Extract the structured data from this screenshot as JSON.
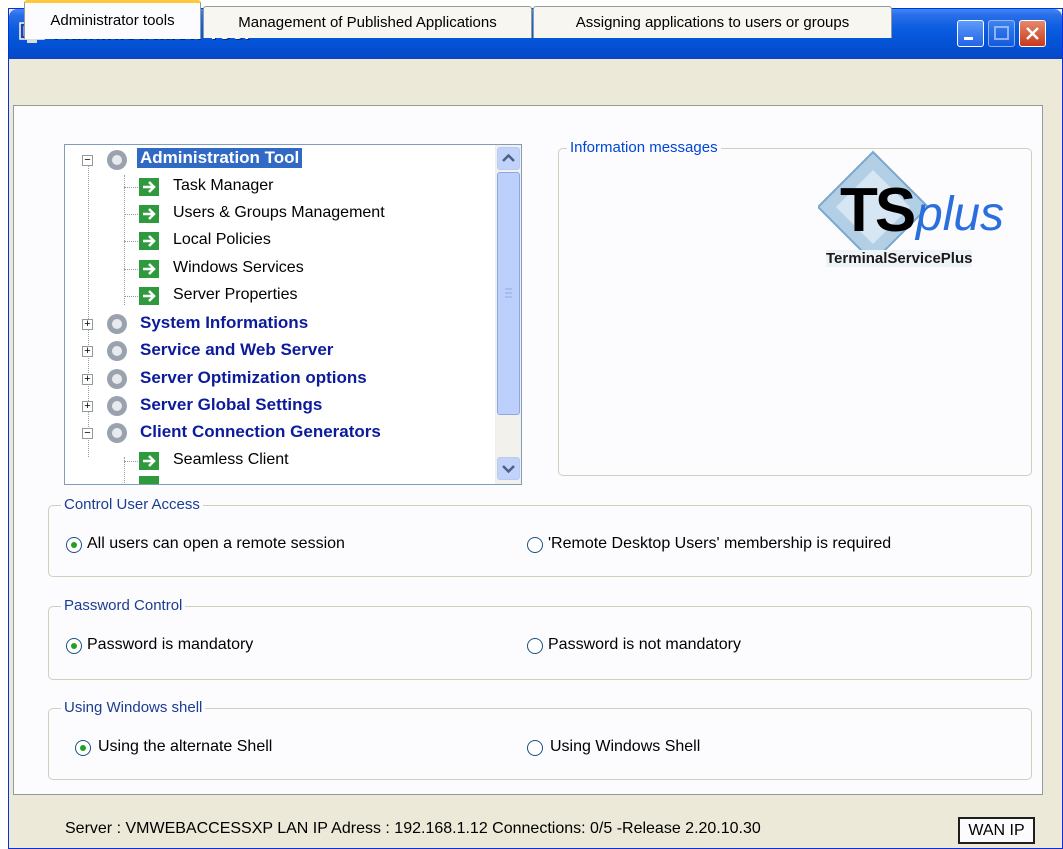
{
  "window": {
    "title": "Administration Tool"
  },
  "tabs": [
    {
      "label": "Administrator tools",
      "active": true
    },
    {
      "label": "Management of Published Applications",
      "active": false
    },
    {
      "label": "Assigning applications to users or groups",
      "active": false
    }
  ],
  "tree": {
    "nodes": [
      {
        "label": "Administration Tool",
        "expanded": true,
        "selected": true,
        "children": [
          "Task Manager",
          "Users & Groups Management",
          "Local Policies",
          "Windows Services",
          "Server Properties"
        ]
      },
      {
        "label": "System Informations",
        "expanded": false
      },
      {
        "label": "Service and Web Server",
        "expanded": false
      },
      {
        "label": "Server Optimization options",
        "expanded": false
      },
      {
        "label": "Server Global Settings",
        "expanded": false
      },
      {
        "label": "Client Connection Generators",
        "expanded": true,
        "children": [
          "Seamless Client"
        ]
      }
    ]
  },
  "info": {
    "title": "Information messages",
    "logo_main": "TS",
    "logo_accent": "plus",
    "logo_sub": "TerminalServicePlus"
  },
  "groups": {
    "access": {
      "title": "Control User Access",
      "option1": "All users can open a remote session",
      "option2": "'Remote Desktop Users' membership is required",
      "selected": 1
    },
    "password": {
      "title": "Password Control",
      "option1": "Password is mandatory",
      "option2": "Password is not mandatory",
      "selected": 1
    },
    "shell": {
      "title": "Using Windows shell",
      "option1": "Using the alternate Shell",
      "option2": "Using Windows Shell",
      "selected": 1
    }
  },
  "status": {
    "text": "Server : VMWEBACCESSXP LAN IP Adress : 192.168.1.12 Connections: 0/5  -Release 2.20.10.30",
    "wan_button": "WAN IP"
  },
  "colors": {
    "titlebar": "#0a5ce0",
    "tab_highlight": "#ffc83c",
    "node_text": "#0b1b9c",
    "selection": "#316ac5",
    "arrow_icon": "#2e9a3d",
    "logo_accent": "#2a6fdb"
  }
}
